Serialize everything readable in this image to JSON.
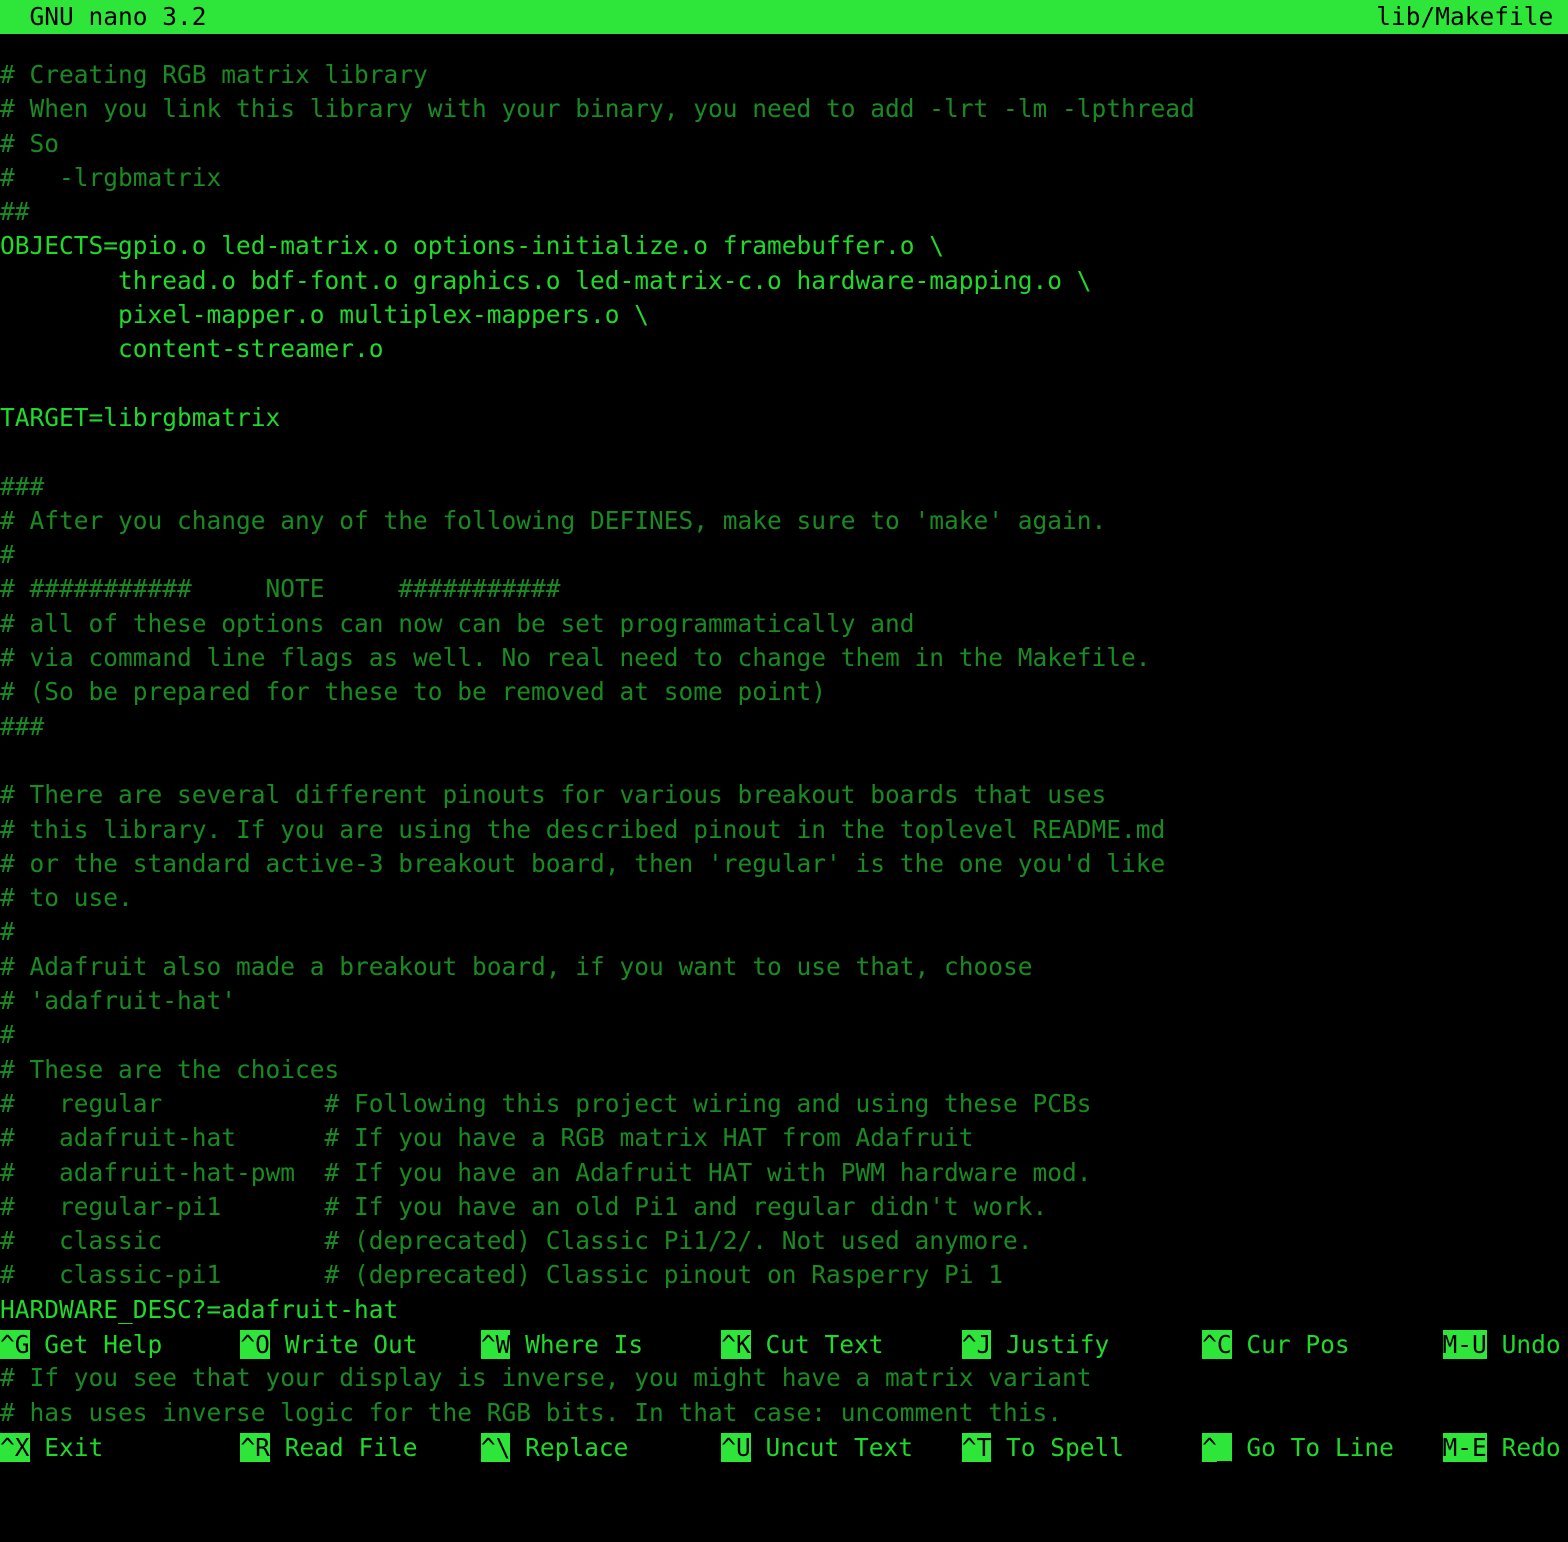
{
  "colors": {
    "background": "#000000",
    "brand_highlight": "#2ee63a",
    "code_text": "#1fd92b",
    "comment_text": "#1a8a22",
    "inverse_text": "#000000"
  },
  "titlebar": {
    "app_name": "GNU nano 3.2",
    "filename": "lib/Makefile"
  },
  "editor": {
    "cursor": {
      "line_index": 37,
      "column": 0,
      "char": "H"
    },
    "lines": [
      {
        "kind": "comment",
        "text": "# Creating RGB matrix library"
      },
      {
        "kind": "comment",
        "text": "# When you link this library with your binary, you need to add -lrt -lm -lpthread"
      },
      {
        "kind": "comment",
        "text": "# So"
      },
      {
        "kind": "comment",
        "text": "#   -lrgbmatrix"
      },
      {
        "kind": "comment",
        "text": "##"
      },
      {
        "kind": "code",
        "text": "OBJECTS=gpio.o led-matrix.o options-initialize.o framebuffer.o \\"
      },
      {
        "kind": "code",
        "text": "        thread.o bdf-font.o graphics.o led-matrix-c.o hardware-mapping.o \\"
      },
      {
        "kind": "code",
        "text": "        pixel-mapper.o multiplex-mappers.o \\"
      },
      {
        "kind": "code",
        "text": "        content-streamer.o"
      },
      {
        "kind": "code",
        "text": ""
      },
      {
        "kind": "code",
        "text": "TARGET=librgbmatrix"
      },
      {
        "kind": "code",
        "text": ""
      },
      {
        "kind": "comment",
        "text": "###"
      },
      {
        "kind": "comment",
        "text": "# After you change any of the following DEFINES, make sure to 'make' again."
      },
      {
        "kind": "comment",
        "text": "#"
      },
      {
        "kind": "comment",
        "text": "# ###########     NOTE     ###########"
      },
      {
        "kind": "comment",
        "text": "# all of these options can now can be set programmatically and"
      },
      {
        "kind": "comment",
        "text": "# via command line flags as well. No real need to change them in the Makefile."
      },
      {
        "kind": "comment",
        "text": "# (So be prepared for these to be removed at some point)"
      },
      {
        "kind": "comment",
        "text": "###"
      },
      {
        "kind": "code",
        "text": ""
      },
      {
        "kind": "comment",
        "text": "# There are several different pinouts for various breakout boards that uses"
      },
      {
        "kind": "comment",
        "text": "# this library. If you are using the described pinout in the toplevel README.md"
      },
      {
        "kind": "comment",
        "text": "# or the standard active-3 breakout board, then 'regular' is the one you'd like"
      },
      {
        "kind": "comment",
        "text": "# to use."
      },
      {
        "kind": "comment",
        "text": "#"
      },
      {
        "kind": "comment",
        "text": "# Adafruit also made a breakout board, if you want to use that, choose"
      },
      {
        "kind": "comment",
        "text": "# 'adafruit-hat'"
      },
      {
        "kind": "comment",
        "text": "#"
      },
      {
        "kind": "comment",
        "text": "# These are the choices"
      },
      {
        "kind": "comment",
        "text": "#   regular           # Following this project wiring and using these PCBs"
      },
      {
        "kind": "comment",
        "text": "#   adafruit-hat      # If you have a RGB matrix HAT from Adafruit"
      },
      {
        "kind": "comment",
        "text": "#   adafruit-hat-pwm  # If you have an Adafruit HAT with PWM hardware mod."
      },
      {
        "kind": "comment",
        "text": "#   regular-pi1       # If you have an old Pi1 and regular didn't work."
      },
      {
        "kind": "comment",
        "text": "#   classic           # (deprecated) Classic Pi1/2/. Not used anymore."
      },
      {
        "kind": "comment",
        "text": "#   classic-pi1       # (deprecated) Classic pinout on Rasperry Pi 1"
      },
      {
        "kind": "code",
        "text": "HARDWARE_DESC?=adafruit-hat"
      },
      {
        "kind": "code",
        "text": ""
      },
      {
        "kind": "comment",
        "text": "# If you see that your display is inverse, you might have a matrix variant"
      },
      {
        "kind": "comment",
        "text": "# has uses inverse logic for the RGB bits. In that case: uncomment this."
      }
    ]
  },
  "helpbar": {
    "row1": [
      {
        "key": "^G",
        "label": " Get Help"
      },
      {
        "key": "^O",
        "label": " Write Out"
      },
      {
        "key": "^W",
        "label": " Where Is"
      },
      {
        "key": "^K",
        "label": " Cut Text"
      },
      {
        "key": "^J",
        "label": " Justify"
      },
      {
        "key": "^C",
        "label": " Cur Pos"
      },
      {
        "key": "M-U",
        "label": " Undo"
      }
    ],
    "row2": [
      {
        "key": "^X",
        "label": " Exit"
      },
      {
        "key": "^R",
        "label": " Read File"
      },
      {
        "key": "^\\",
        "label": " Replace"
      },
      {
        "key": "^U",
        "label": " Uncut Text"
      },
      {
        "key": "^T",
        "label": " To Spell"
      },
      {
        "key": "^_",
        "label": " Go To Line"
      },
      {
        "key": "M-E",
        "label": " Redo"
      }
    ]
  }
}
